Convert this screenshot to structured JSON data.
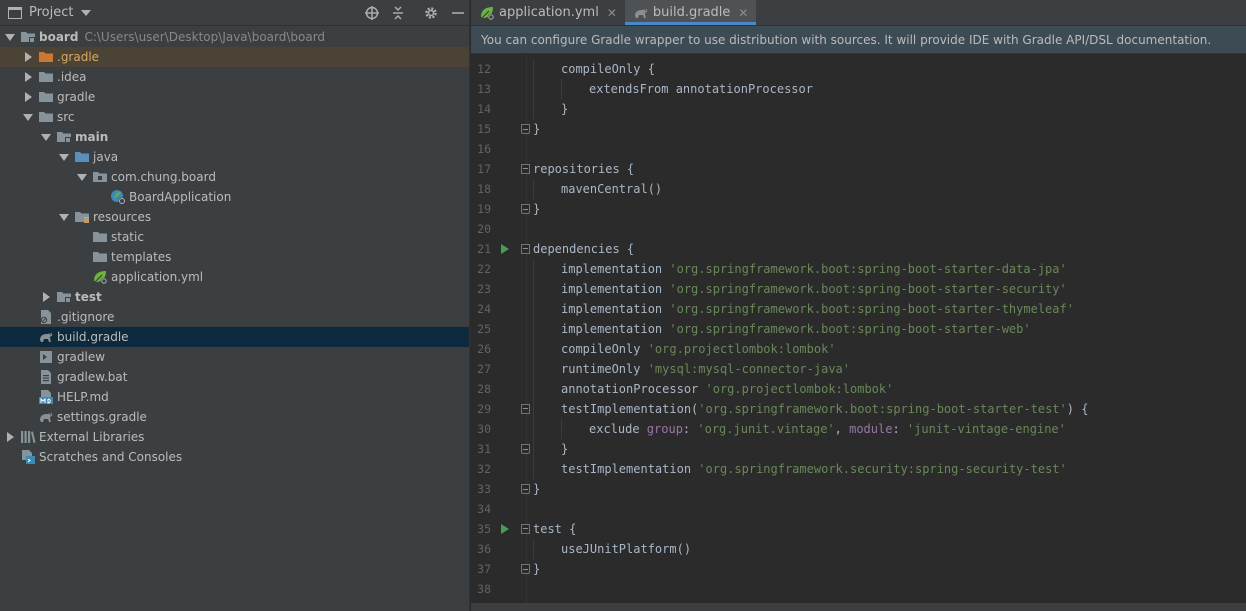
{
  "project_panel": {
    "title": "Project",
    "tree": [
      {
        "label": "board",
        "path": "C:\\Users\\user\\Desktop\\Java\\board\\board",
        "depth": 0,
        "arrow": "down",
        "icon": "module-folder-icon",
        "bold": true
      },
      {
        "label": ".gradle",
        "depth": 1,
        "arrow": "right",
        "icon": "orange-folder-icon",
        "highlight": true
      },
      {
        "label": ".idea",
        "depth": 1,
        "arrow": "right",
        "icon": "folder-icon"
      },
      {
        "label": "gradle",
        "depth": 1,
        "arrow": "right",
        "icon": "folder-icon"
      },
      {
        "label": "src",
        "depth": 1,
        "arrow": "down",
        "icon": "folder-icon"
      },
      {
        "label": "main",
        "depth": 2,
        "arrow": "down",
        "icon": "module-folder-icon",
        "bold": true
      },
      {
        "label": "java",
        "depth": 3,
        "arrow": "down",
        "icon": "source-folder-icon"
      },
      {
        "label": "com.chung.board",
        "depth": 4,
        "arrow": "down",
        "icon": "package-icon"
      },
      {
        "label": "BoardApplication",
        "depth": 5,
        "arrow": "none",
        "icon": "spring-class-icon"
      },
      {
        "label": "resources",
        "depth": 3,
        "arrow": "down",
        "icon": "resources-folder-icon"
      },
      {
        "label": "static",
        "depth": 4,
        "arrow": "none",
        "icon": "folder-icon"
      },
      {
        "label": "templates",
        "depth": 4,
        "arrow": "none",
        "icon": "folder-icon"
      },
      {
        "label": "application.yml",
        "depth": 4,
        "arrow": "none",
        "icon": "yml-leaf-icon"
      },
      {
        "label": "test",
        "depth": 2,
        "arrow": "right",
        "icon": "module-folder-icon",
        "bold": true
      },
      {
        "label": ".gitignore",
        "depth": 1,
        "arrow": "none",
        "icon": "gitignore-file-icon"
      },
      {
        "label": "build.gradle",
        "depth": 1,
        "arrow": "none",
        "icon": "gradle-elephant-icon",
        "selected": true
      },
      {
        "label": "gradlew",
        "depth": 1,
        "arrow": "none",
        "icon": "shell-script-icon"
      },
      {
        "label": "gradlew.bat",
        "depth": 1,
        "arrow": "none",
        "icon": "text-file-icon"
      },
      {
        "label": "HELP.md",
        "depth": 1,
        "arrow": "none",
        "icon": "markdown-file-icon"
      },
      {
        "label": "settings.gradle",
        "depth": 1,
        "arrow": "none",
        "icon": "gradle-elephant-icon"
      },
      {
        "label": "External Libraries",
        "depth": 0,
        "arrow": "right",
        "icon": "libraries-icon"
      },
      {
        "label": "Scratches and Consoles",
        "depth": 0,
        "arrow": "none",
        "icon": "scratches-icon"
      }
    ]
  },
  "editor": {
    "tabs": [
      {
        "label": "application.yml",
        "icon": "yml-leaf-icon",
        "active": false
      },
      {
        "label": "build.gradle",
        "icon": "gradle-elephant-icon",
        "active": true
      }
    ],
    "notification": "You can configure Gradle wrapper to use distribution with sources. It will provide IDE with Gradle API/DSL documentation.",
    "lines": [
      {
        "n": "12",
        "indent": 1,
        "fold": "",
        "run": false,
        "parts": [
          {
            "t": "compileOnly {",
            "c": ""
          }
        ]
      },
      {
        "n": "13",
        "indent": 2,
        "fold": "",
        "run": false,
        "parts": [
          {
            "t": "extendsFrom annotationProcessor",
            "c": ""
          }
        ]
      },
      {
        "n": "14",
        "indent": 1,
        "fold": "",
        "run": false,
        "parts": [
          {
            "t": "}",
            "c": ""
          }
        ]
      },
      {
        "n": "15",
        "indent": 0,
        "fold": "close",
        "run": false,
        "parts": [
          {
            "t": "}",
            "c": ""
          }
        ]
      },
      {
        "n": "16",
        "indent": 0,
        "fold": "",
        "run": false,
        "parts": []
      },
      {
        "n": "17",
        "indent": 0,
        "fold": "open",
        "run": false,
        "parts": [
          {
            "t": "repositories {",
            "c": ""
          }
        ]
      },
      {
        "n": "18",
        "indent": 1,
        "fold": "",
        "run": false,
        "parts": [
          {
            "t": "mavenCentral()",
            "c": ""
          }
        ]
      },
      {
        "n": "19",
        "indent": 0,
        "fold": "close",
        "run": false,
        "parts": [
          {
            "t": "}",
            "c": ""
          }
        ]
      },
      {
        "n": "20",
        "indent": 0,
        "fold": "",
        "run": false,
        "parts": []
      },
      {
        "n": "21",
        "indent": 0,
        "fold": "open",
        "run": true,
        "parts": [
          {
            "t": "dependencies {",
            "c": ""
          }
        ]
      },
      {
        "n": "22",
        "indent": 1,
        "fold": "",
        "run": false,
        "parts": [
          {
            "t": "implementation ",
            "c": ""
          },
          {
            "t": "'org.springframework.boot:spring-boot-starter-data-jpa'",
            "c": "str"
          }
        ]
      },
      {
        "n": "23",
        "indent": 1,
        "fold": "",
        "run": false,
        "parts": [
          {
            "t": "implementation ",
            "c": ""
          },
          {
            "t": "'org.springframework.boot:spring-boot-starter-security'",
            "c": "str"
          }
        ]
      },
      {
        "n": "24",
        "indent": 1,
        "fold": "",
        "run": false,
        "parts": [
          {
            "t": "implementation ",
            "c": ""
          },
          {
            "t": "'org.springframework.boot:spring-boot-starter-thymeleaf'",
            "c": "str"
          }
        ]
      },
      {
        "n": "25",
        "indent": 1,
        "fold": "",
        "run": false,
        "parts": [
          {
            "t": "implementation ",
            "c": ""
          },
          {
            "t": "'org.springframework.boot:spring-boot-starter-web'",
            "c": "str"
          }
        ]
      },
      {
        "n": "26",
        "indent": 1,
        "fold": "",
        "run": false,
        "parts": [
          {
            "t": "compileOnly ",
            "c": ""
          },
          {
            "t": "'org.projectlombok:lombok'",
            "c": "str"
          }
        ]
      },
      {
        "n": "27",
        "indent": 1,
        "fold": "",
        "run": false,
        "parts": [
          {
            "t": "runtimeOnly ",
            "c": ""
          },
          {
            "t": "'mysql:mysql-connector-java'",
            "c": "str"
          }
        ]
      },
      {
        "n": "28",
        "indent": 1,
        "fold": "",
        "run": false,
        "parts": [
          {
            "t": "annotationProcessor ",
            "c": ""
          },
          {
            "t": "'org.projectlombok:lombok'",
            "c": "str"
          }
        ]
      },
      {
        "n": "29",
        "indent": 1,
        "fold": "open",
        "run": false,
        "parts": [
          {
            "t": "testImplementation(",
            "c": ""
          },
          {
            "t": "'org.springframework.boot:spring-boot-starter-test'",
            "c": "str"
          },
          {
            "t": ") {",
            "c": ""
          }
        ]
      },
      {
        "n": "30",
        "indent": 2,
        "fold": "",
        "run": false,
        "parts": [
          {
            "t": "exclude ",
            "c": ""
          },
          {
            "t": "group",
            "c": "named"
          },
          {
            "t": ": ",
            "c": ""
          },
          {
            "t": "'org.junit.vintage'",
            "c": "str"
          },
          {
            "t": ", ",
            "c": ""
          },
          {
            "t": "module",
            "c": "named"
          },
          {
            "t": ": ",
            "c": ""
          },
          {
            "t": "'junit-vintage-engine'",
            "c": "str"
          }
        ]
      },
      {
        "n": "31",
        "indent": 1,
        "fold": "close",
        "run": false,
        "parts": [
          {
            "t": "}",
            "c": ""
          }
        ]
      },
      {
        "n": "32",
        "indent": 1,
        "fold": "",
        "run": false,
        "parts": [
          {
            "t": "testImplementation ",
            "c": ""
          },
          {
            "t": "'org.springframework.security:spring-security-test'",
            "c": "str"
          }
        ]
      },
      {
        "n": "33",
        "indent": 0,
        "fold": "close",
        "run": false,
        "parts": [
          {
            "t": "}",
            "c": ""
          }
        ]
      },
      {
        "n": "34",
        "indent": 0,
        "fold": "",
        "run": false,
        "parts": []
      },
      {
        "n": "35",
        "indent": 0,
        "fold": "open",
        "run": true,
        "parts": [
          {
            "t": "test {",
            "c": ""
          }
        ]
      },
      {
        "n": "36",
        "indent": 1,
        "fold": "",
        "run": false,
        "parts": [
          {
            "t": "useJUnitPlatform()",
            "c": ""
          }
        ]
      },
      {
        "n": "37",
        "indent": 0,
        "fold": "close",
        "run": false,
        "parts": [
          {
            "t": "}",
            "c": ""
          }
        ]
      },
      {
        "n": "38",
        "indent": 0,
        "fold": "",
        "run": false,
        "parts": []
      }
    ]
  },
  "colors": {
    "panel_bg": "#3c3f41",
    "editor_bg": "#2b2b2b",
    "selection": "#0d293e",
    "accent": "#4a88c7",
    "string": "#6a8759",
    "named_arg": "#9876aa",
    "run_green": "#499c54"
  }
}
